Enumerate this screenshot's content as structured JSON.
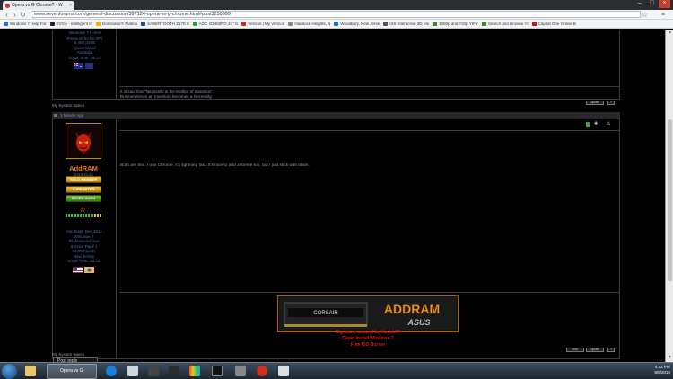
{
  "browser": {
    "tab_title": "Opera vs G Chrome? - W",
    "url": "www.sevenforums.com/general-discussion/397124-opera-vs-g-chrome.html#post3258999",
    "bookmarks": [
      {
        "label": "Windows 7 Help For",
        "color": "#2a6fd1"
      },
      {
        "label": "EVGA - Intelligent In",
        "color": "#222222"
      },
      {
        "label": "Dominator® Platinu",
        "color": "#f0b400"
      },
      {
        "label": "SABERTOOTH Z170 S",
        "color": "#1f4a8a"
      },
      {
        "label": "AOC G2460PG 24\" G",
        "color": "#2ea043"
      },
      {
        "label": "Verizon | My Verizon",
        "color": "#d52b1e"
      },
      {
        "label": "Haddock Heights, N",
        "color": "#888888"
      },
      {
        "label": "Woodbury, New Jerse",
        "color": "#1f6fd1"
      },
      {
        "label": "ISS Interactive 3D Vie",
        "color": "#555555"
      },
      {
        "label": "1080p and 720p YIFY",
        "color": "#3b7d2c"
      },
      {
        "label": "Search and Browse YI",
        "color": "#3b7d2c"
      },
      {
        "label": "Capital One Online B",
        "color": "#c4161c"
      }
    ]
  },
  "post1": {
    "user_stats": [
      "Windows 7 Home",
      "Premium 64 bit SP1",
      "5,495 posts",
      "Queensland",
      "Australia",
      "Local Time: 08:17"
    ],
    "sig_line1": "It is said that \"Necessity is the Mother of Invention\",",
    "sig_line2": "But sometimes an Invention becomes a Necessity.",
    "specs": "My System Specs"
  },
  "post2": {
    "time": "1 Minute Ago",
    "username": "AddRAM",
    "user_title": "SJ15 Guru",
    "badges": [
      "GOLD MEMBER",
      "SUPPORTER",
      "SEVEN GURU"
    ],
    "user_stats": [
      "Join Date: Dec 2011",
      "Windows 7",
      "Professional x64",
      "Service Pack 1",
      "11,063 posts",
      "New Jersey",
      "Local Time: 03:42"
    ],
    "message": "Both are fine, I use Chrome, it's lightning fast. It's nice to add a theme too, but I just stick with black.",
    "sig_credit1": "Signature created by Hadsh97",
    "sig_credit2": "Clean Install Windows 7",
    "sig_credit3": "Free ISO Burner",
    "specs": "My System Specs",
    "quick_reply": "Post reply",
    "banner_text": "ADDRAM",
    "banner_sub": "ASUS",
    "banner_corsair": "CORSAIR"
  },
  "taskbar": {
    "active_label": "Opera vs G Chro...",
    "time": "4:42 PM",
    "date": "6/8/2016"
  }
}
